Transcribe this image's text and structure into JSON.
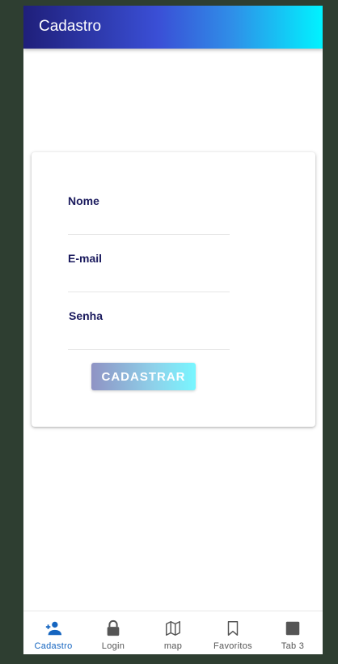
{
  "header": {
    "title": "Cadastro"
  },
  "form": {
    "fields": [
      {
        "label": "Nome"
      },
      {
        "label": "E-mail"
      },
      {
        "label": "Senha"
      }
    ],
    "submit_label": "CADASTRAR"
  },
  "tabs": [
    {
      "label": "Cadastro",
      "icon": "person-add-icon",
      "active": true
    },
    {
      "label": "Login",
      "icon": "lock-icon",
      "active": false
    },
    {
      "label": "map",
      "icon": "map-icon",
      "active": false
    },
    {
      "label": "Favoritos",
      "icon": "bookmark-icon",
      "active": false
    },
    {
      "label": "Tab 3",
      "icon": "square-icon",
      "active": false
    }
  ],
  "colors": {
    "accent": "#1565c0",
    "label": "#1b1b5e",
    "background": "#2e3e31"
  }
}
